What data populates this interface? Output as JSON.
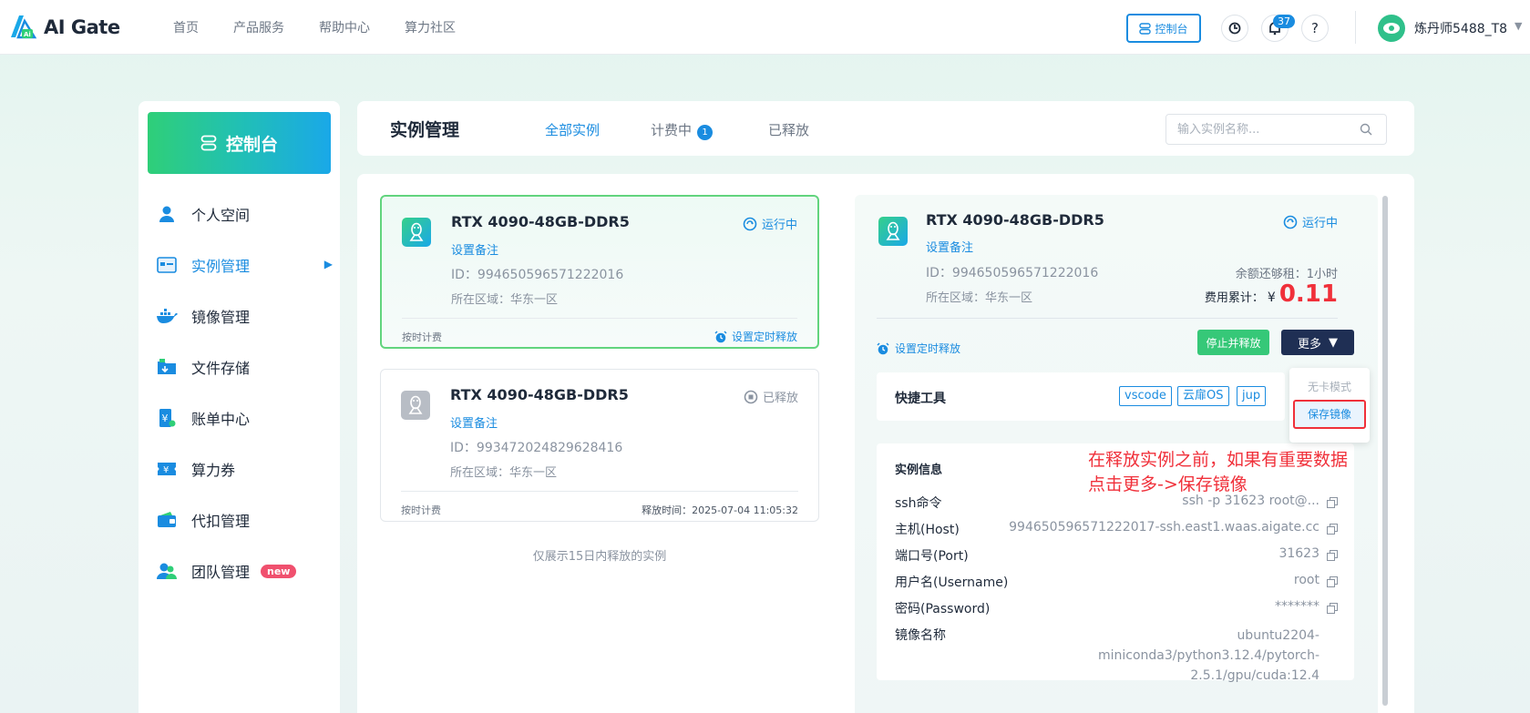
{
  "brand": {
    "name": "AI Gate"
  },
  "nav": [
    "首页",
    "产品服务",
    "帮助中心",
    "算力社区"
  ],
  "header": {
    "console_label": "控制台",
    "notification_count": "37",
    "help_label": "?",
    "username": "炼丹师5488_T8"
  },
  "sidebar": {
    "title": "控制台",
    "items": [
      {
        "label": "个人空间",
        "icon": "user-icon"
      },
      {
        "label": "实例管理",
        "icon": "instance-icon"
      },
      {
        "label": "镜像管理",
        "icon": "docker-icon"
      },
      {
        "label": "文件存储",
        "icon": "folder-icon"
      },
      {
        "label": "账单中心",
        "icon": "bill-icon"
      },
      {
        "label": "算力券",
        "icon": "coupon-icon"
      },
      {
        "label": "代扣管理",
        "icon": "wallet-icon"
      },
      {
        "label": "团队管理",
        "icon": "team-icon"
      }
    ],
    "new_badge": "new"
  },
  "page": {
    "title": "实例管理",
    "tabs": [
      {
        "label": "全部实例"
      },
      {
        "label": "计费中",
        "count": "1"
      },
      {
        "label": "已释放"
      }
    ],
    "search_placeholder": "输入实例名称..."
  },
  "instances": [
    {
      "name": "RTX 4090-48GB-DDR5",
      "note_label": "设置备注",
      "id": "ID：994650596571222016",
      "region": "所在区域：华东一区",
      "status": "运行中",
      "billing": "按时计费",
      "action": "设置定时释放"
    },
    {
      "name": "RTX 4090-48GB-DDR5",
      "note_label": "设置备注",
      "id": "ID：993472024829628416",
      "region": "所在区域：华东一区",
      "status": "已释放",
      "billing": "按时计费",
      "release_time": "释放时间：2025-07-04 11:05:32"
    }
  ],
  "list_footer": "仅展示15日内释放的实例",
  "detail": {
    "name": "RTX 4090-48GB-DDR5",
    "note_label": "设置备注",
    "id": "ID：994650596571222016",
    "region": "所在区域：华东一区",
    "status": "运行中",
    "balance": "余额还够租：1小时",
    "cost_label": "费用累计：",
    "cost_currency": "¥",
    "cost_value": "0.11",
    "timer_label": "设置定时释放",
    "stop_label": "停止并释放",
    "more_label": "更多",
    "dropdown": [
      "无卡模式",
      "保存镜像"
    ],
    "quick_tools_label": "快捷工具",
    "tools": [
      "vscode",
      "云扉OS",
      "jup"
    ],
    "info_title": "实例信息",
    "info": [
      {
        "key": "ssh命令",
        "value": "ssh -p 31623 root@..."
      },
      {
        "key": "主机(Host)",
        "value": "994650596571222017-ssh.east1.waas.aigate.cc"
      },
      {
        "key": "端口号(Port)",
        "value": "31623"
      },
      {
        "key": "用户名(Username)",
        "value": "root"
      },
      {
        "key": "密码(Password)",
        "value": "*******"
      }
    ],
    "image_label": "镜像名称",
    "image_value": "ubuntu2204-miniconda3/python3.12.4/pytorch-2.5.1/gpu/cuda:12.4"
  },
  "annotation": {
    "line1": "在释放实例之前，如果有重要数据",
    "line2": "点击更多->保存镜像"
  },
  "colors": {
    "accent": "#1a8ce0",
    "success": "#36c878",
    "danger": "#f0303a",
    "dark_button": "#1f2f54"
  }
}
